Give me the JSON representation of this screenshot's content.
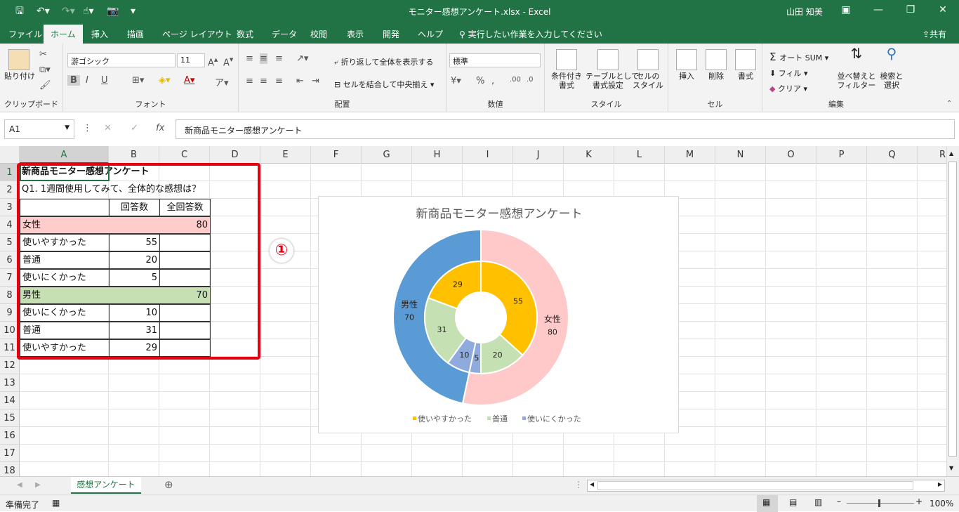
{
  "window": {
    "title": "モニター感想アンケート.xlsx  -  Excel",
    "user": "山田 知美"
  },
  "tabs": [
    {
      "label": "ファイル"
    },
    {
      "label": "ホーム"
    },
    {
      "label": "挿入"
    },
    {
      "label": "描画"
    },
    {
      "label": "ページ レイアウト"
    },
    {
      "label": "数式"
    },
    {
      "label": "データ"
    },
    {
      "label": "校閲"
    },
    {
      "label": "表示"
    },
    {
      "label": "開発"
    },
    {
      "label": "ヘルプ"
    }
  ],
  "tell_me": "実行したい作業を入力してください",
  "share": "共有",
  "ribbon": {
    "clipboard": {
      "paste": "貼り付け",
      "group": "クリップボード"
    },
    "font": {
      "name": "游ゴシック",
      "size": "11",
      "group": "フォント",
      "bold": "B",
      "italic": "I",
      "underline": "U"
    },
    "alignment": {
      "wrap": "折り返して全体を表示する",
      "merge": "セルを結合して中央揃え",
      "group": "配置"
    },
    "number": {
      "format": "標準",
      "group": "数値"
    },
    "styles": {
      "cond": "条件付き\n書式",
      "table": "テーブルとして\n書式設定",
      "cell": "セルの\nスタイル",
      "group": "スタイル"
    },
    "cells": {
      "insert": "挿入",
      "delete": "削除",
      "format": "書式",
      "group": "セル"
    },
    "editing": {
      "autosum": "オート SUM",
      "fill": "フィル",
      "clear": "クリア",
      "sort": "並べ替えと\nフィルター",
      "find": "検索と\n選択",
      "group": "編集"
    }
  },
  "formula_bar": {
    "name_box": "A1",
    "content": "新商品モニター感想アンケート"
  },
  "columns": [
    "A",
    "B",
    "C",
    "D",
    "E",
    "F",
    "G",
    "H",
    "I",
    "J",
    "K",
    "L",
    "M",
    "N",
    "O",
    "P",
    "Q",
    "R"
  ],
  "rows": [
    "1",
    "2",
    "3",
    "4",
    "5",
    "6",
    "7",
    "8",
    "9",
    "10",
    "11",
    "12",
    "13",
    "14",
    "15",
    "16",
    "17",
    "18"
  ],
  "sheet": {
    "a1": "新商品モニター感想アンケート",
    "a2": "Q1. 1週間使用してみて、全体的な感想は？",
    "b3": "回答数",
    "c3": "全回答数",
    "a4": "女性",
    "c4": "80",
    "a5": "使いやすかった",
    "b5": "55",
    "a6": "普通",
    "b6": "20",
    "a7": "使いにくかった",
    "b7": "5",
    "a8": "男性",
    "c8": "70",
    "a9": "使いにくかった",
    "b9": "10",
    "a10": "普通",
    "b10": "31",
    "a11": "使いやすかった",
    "b11": "29"
  },
  "callout": "①",
  "colors": {
    "women": "#ffc9c9",
    "men": "#5b9bd5",
    "easy": "#ffc000",
    "normal": "#c5e0b3",
    "hard": "#8faadc",
    "pinkFill": "#ffcccc",
    "greenFill": "#c6e0b4"
  },
  "chart_data": {
    "type": "doughnut",
    "title": "新商品モニター感想アンケート",
    "outer_ring": [
      {
        "label": "女性",
        "value": 80
      },
      {
        "label": "男性",
        "value": 70
      }
    ],
    "inner_ring": [
      {
        "group": "女性",
        "category": "使いやすかった",
        "value": 55
      },
      {
        "group": "女性",
        "category": "普通",
        "value": 20
      },
      {
        "group": "女性",
        "category": "使いにくかった",
        "value": 5
      },
      {
        "group": "男性",
        "category": "使いにくかった",
        "value": 10
      },
      {
        "group": "男性",
        "category": "普通",
        "value": 31
      },
      {
        "group": "男性",
        "category": "使いやすかった",
        "value": 29
      }
    ],
    "legend": [
      "使いやすかった",
      "普通",
      "使いにくかった"
    ],
    "legend_position": "bottom"
  },
  "sheet_tab": "感想アンケート",
  "status": {
    "ready": "準備完了",
    "zoom": "100%"
  }
}
